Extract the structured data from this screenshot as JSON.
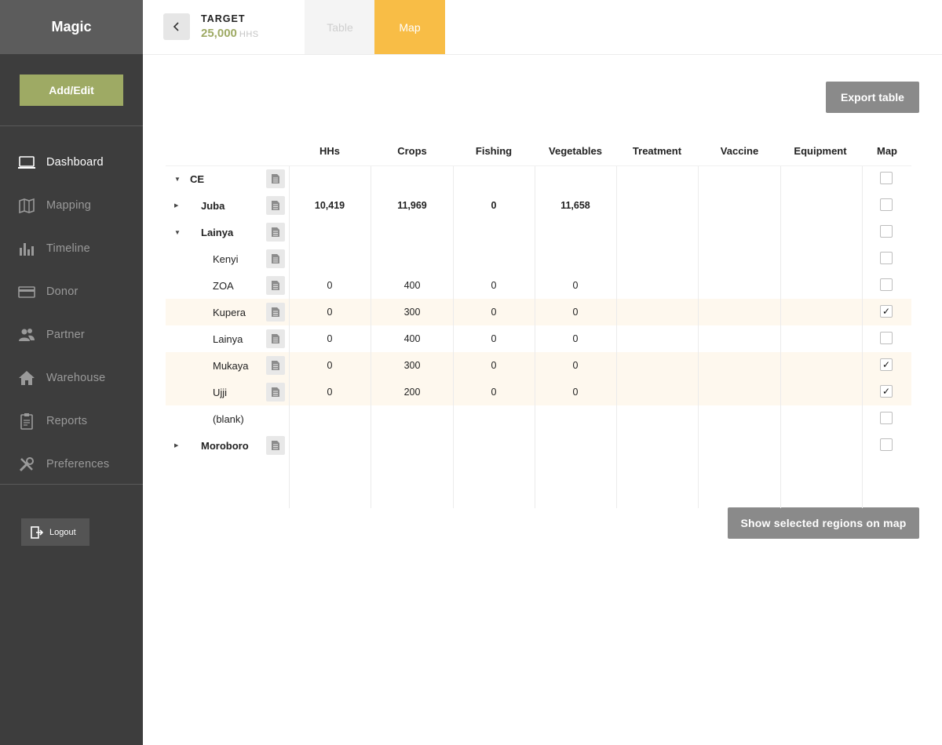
{
  "app": {
    "title": "Magic"
  },
  "sidebar": {
    "add_edit_label": "Add/Edit",
    "items": [
      {
        "label": "Dashboard",
        "icon": "laptop-icon",
        "active": true
      },
      {
        "label": "Mapping",
        "icon": "map-icon",
        "active": false
      },
      {
        "label": "Timeline",
        "icon": "bar-chart-icon",
        "active": false
      },
      {
        "label": "Donor",
        "icon": "credit-card-icon",
        "active": false
      },
      {
        "label": "Partner",
        "icon": "users-icon",
        "active": false
      },
      {
        "label": "Warehouse",
        "icon": "home-icon",
        "active": false
      },
      {
        "label": "Reports",
        "icon": "clipboard-icon",
        "active": false
      },
      {
        "label": "Preferences",
        "icon": "tools-icon",
        "active": false
      }
    ],
    "logout_label": "Logout"
  },
  "header": {
    "target_label": "TARGET",
    "target_value": "25,000",
    "target_unit": "HHS",
    "tabs": [
      {
        "label": "Table",
        "active": false
      },
      {
        "label": "Map",
        "active": true
      }
    ]
  },
  "actions": {
    "export_label": "Export table",
    "show_map_label": "Show selected regions on map"
  },
  "table": {
    "columns": [
      "HHs",
      "Crops",
      "Fishing",
      "Vegetables",
      "Treatment",
      "Vaccine",
      "Equipment",
      "Map"
    ],
    "rows": [
      {
        "name": "CE",
        "level": 0,
        "expander": "expanded",
        "doc": true,
        "values": [
          "",
          "",
          "",
          "",
          "",
          "",
          ""
        ],
        "checked": false,
        "highlight": false
      },
      {
        "name": "Juba",
        "level": 1,
        "expander": "collapsed",
        "doc": true,
        "values": [
          "10,419",
          "11,969",
          "0",
          "11,658",
          "",
          "",
          ""
        ],
        "checked": false,
        "highlight": false
      },
      {
        "name": "Lainya",
        "level": 1,
        "expander": "expanded",
        "doc": true,
        "values": [
          "",
          "",
          "",
          "",
          "",
          "",
          ""
        ],
        "checked": false,
        "highlight": false
      },
      {
        "name": "Kenyi",
        "level": 2,
        "expander": "",
        "doc": true,
        "values": [
          "",
          "",
          "",
          "",
          "",
          "",
          ""
        ],
        "checked": false,
        "highlight": false
      },
      {
        "name": "ZOA",
        "level": 2,
        "expander": "",
        "doc": true,
        "values": [
          "0",
          "400",
          "0",
          "0",
          "",
          "",
          ""
        ],
        "checked": false,
        "highlight": false
      },
      {
        "name": "Kupera",
        "level": 2,
        "expander": "",
        "doc": true,
        "values": [
          "0",
          "300",
          "0",
          "0",
          "",
          "",
          ""
        ],
        "checked": true,
        "highlight": true
      },
      {
        "name": "Lainya",
        "level": 2,
        "expander": "",
        "doc": true,
        "values": [
          "0",
          "400",
          "0",
          "0",
          "",
          "",
          ""
        ],
        "checked": false,
        "highlight": false
      },
      {
        "name": "Mukaya",
        "level": 2,
        "expander": "",
        "doc": true,
        "values": [
          "0",
          "300",
          "0",
          "0",
          "",
          "",
          ""
        ],
        "checked": true,
        "highlight": true
      },
      {
        "name": "Ujji",
        "level": 2,
        "expander": "",
        "doc": true,
        "values": [
          "0",
          "200",
          "0",
          "0",
          "",
          "",
          ""
        ],
        "checked": true,
        "highlight": true
      },
      {
        "name": "(blank)",
        "level": 2,
        "expander": "",
        "doc": false,
        "values": [
          "",
          "",
          "",
          "",
          "",
          "",
          ""
        ],
        "checked": false,
        "highlight": false
      },
      {
        "name": "Moroboro",
        "level": 1,
        "expander": "collapsed",
        "doc": true,
        "values": [
          "",
          "",
          "",
          "",
          "",
          "",
          ""
        ],
        "checked": false,
        "highlight": false
      }
    ]
  },
  "colors": {
    "sidebar_bg": "#3d3d3d",
    "brand_bg": "#5c5c5c",
    "accent_green": "#9eaa64",
    "accent_orange": "#f8bd46",
    "button_gray": "#8a8a8a",
    "highlight_row": "#fef8ee"
  }
}
